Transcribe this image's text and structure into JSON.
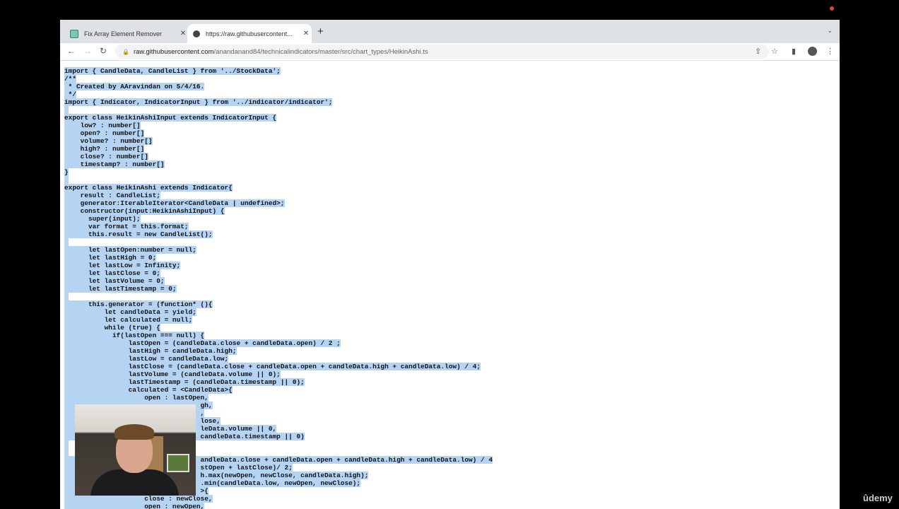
{
  "browser": {
    "tabs": [
      {
        "label": "Fix Array Element Remover",
        "active": false
      },
      {
        "label": "https://raw.githubusercontent...",
        "active": true
      }
    ],
    "url_host": "raw.githubusercontent.com",
    "url_path": "/anandanand84/technicalindicators/master/src/chart_types/HeikinAshi.ts",
    "icons": {
      "back": "←",
      "forward": "→",
      "reload": "↻",
      "lock": "🔒",
      "share": "⇪",
      "star": "☆",
      "sidebar": "▮",
      "menu": "⋮",
      "close": "✕",
      "new_tab": "+",
      "tab_menu": "⌄"
    }
  },
  "code_lines": [
    "import { CandleData, CandleList } from '../StockData';",
    "/**",
    " * Created by AAravindan on 5/4/16.",
    " */",
    "import { Indicator, IndicatorInput } from '../indicator/indicator';",
    "",
    "export class HeikinAshiInput extends IndicatorInput {",
    "    low? : number[]",
    "    open? : number[]",
    "    volume? : number[]",
    "    high? : number[]",
    "    close? : number[]",
    "    timestamp? : number[]",
    "}",
    "",
    "export class HeikinAshi extends Indicator{",
    "    result : CandleList;",
    "    generator:IterableIterator<CandleData | undefined>;",
    "    constructor(input:HeikinAshiInput) {",
    "      super(input);",
    "      var format = this.format;",
    "      this.result = new CandleList();",
    "",
    "      let lastOpen:number = null;",
    "      let lastHigh = 0;",
    "      let lastLow = Infinity;",
    "      let lastClose = 0;",
    "      let lastVolume = 0;",
    "      let lastTimestamp = 0;",
    "",
    "      this.generator = (function* (){",
    "          let candleData = yield;",
    "          let calculated = null;",
    "          while (true) {",
    "            if(lastOpen === null) {",
    "                lastOpen = (candleData.close + candleData.open) / 2 ;",
    "                lastHigh = candleData.high;",
    "                lastLow = candleData.low;",
    "                lastClose = (candleData.close + candleData.open + candleData.high + candleData.low) / 4;",
    "                lastVolume = (candleData.volume || 0);",
    "                lastTimestamp = (candleData.timestamp || 0);",
    "                calculated = <CandleData>{",
    "                    open : lastOpen,",
    "                                  gh,",
    "                                  ,",
    "                                  lose,",
    "                                  leData.volume || 0,",
    "                                  candleData.timestamp || 0)",
    "",
    "",
    "                                  andleData.close + candleData.open + candleData.high + candleData.low) / 4",
    "                                  stOpen + lastClose)/ 2;",
    "                                  h.max(newOpen, newClose, candleData.high);",
    "                                  .min(candleData.low, newOpen, newClose);",
    "                                  >{",
    "                    close : newClose,",
    "                    open : newOpen,"
  ],
  "watermark": "ûdemy"
}
